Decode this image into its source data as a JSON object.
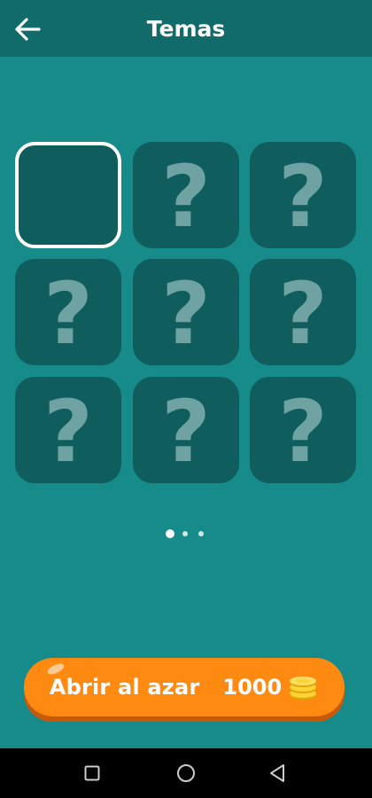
{
  "header": {
    "title": "Temas",
    "back_icon": "arrow-left-icon"
  },
  "grid": {
    "tiles": [
      {
        "state": "selected",
        "label": ""
      },
      {
        "state": "locked",
        "label": "?"
      },
      {
        "state": "locked",
        "label": "?"
      },
      {
        "state": "locked",
        "label": "?"
      },
      {
        "state": "locked",
        "label": "?"
      },
      {
        "state": "locked",
        "label": "?"
      },
      {
        "state": "locked",
        "label": "?"
      },
      {
        "state": "locked",
        "label": "?"
      },
      {
        "state": "locked",
        "label": "?"
      }
    ]
  },
  "pager": {
    "pages": 3,
    "current": 1
  },
  "cta": {
    "label": "Abrir al azar",
    "price": "1000",
    "icon": "coins-icon"
  },
  "system_nav": {
    "recents_icon": "square-icon",
    "home_icon": "circle-icon",
    "back_icon": "triangle-back-icon"
  },
  "colors": {
    "background": "#178a8a",
    "header": "#116b6b",
    "tile": "#0f5d5d",
    "button": "#ff8a12"
  }
}
